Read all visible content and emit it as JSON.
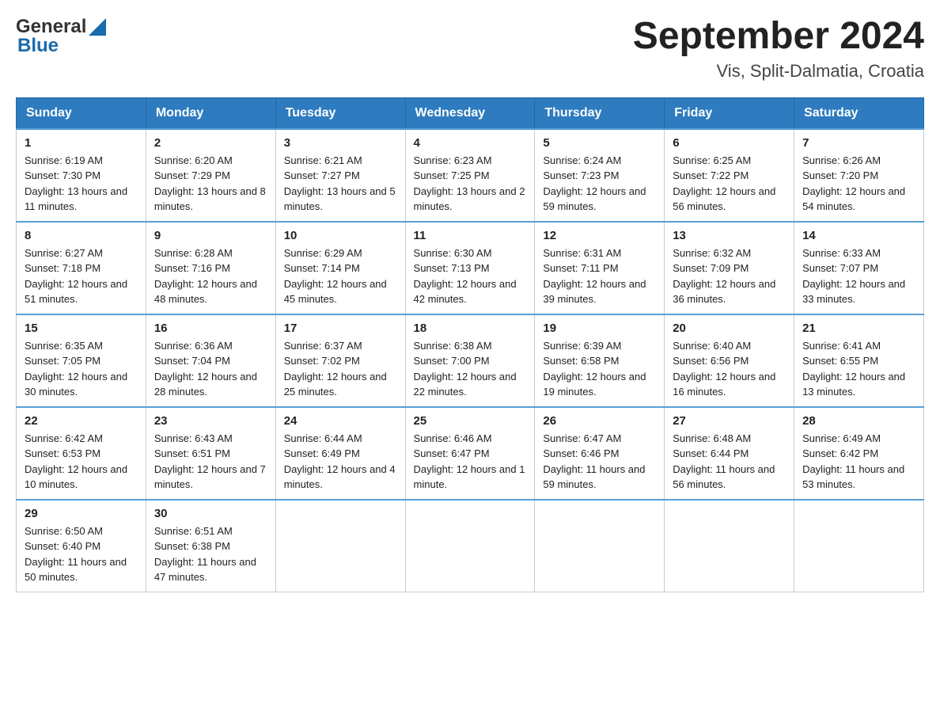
{
  "header": {
    "logo": {
      "general": "General",
      "blue": "Blue"
    },
    "title": "September 2024",
    "location": "Vis, Split-Dalmatia, Croatia"
  },
  "weekdays": [
    "Sunday",
    "Monday",
    "Tuesday",
    "Wednesday",
    "Thursday",
    "Friday",
    "Saturday"
  ],
  "weeks": [
    [
      {
        "day": "1",
        "sunrise": "6:19 AM",
        "sunset": "7:30 PM",
        "daylight": "13 hours and 11 minutes."
      },
      {
        "day": "2",
        "sunrise": "6:20 AM",
        "sunset": "7:29 PM",
        "daylight": "13 hours and 8 minutes."
      },
      {
        "day": "3",
        "sunrise": "6:21 AM",
        "sunset": "7:27 PM",
        "daylight": "13 hours and 5 minutes."
      },
      {
        "day": "4",
        "sunrise": "6:23 AM",
        "sunset": "7:25 PM",
        "daylight": "13 hours and 2 minutes."
      },
      {
        "day": "5",
        "sunrise": "6:24 AM",
        "sunset": "7:23 PM",
        "daylight": "12 hours and 59 minutes."
      },
      {
        "day": "6",
        "sunrise": "6:25 AM",
        "sunset": "7:22 PM",
        "daylight": "12 hours and 56 minutes."
      },
      {
        "day": "7",
        "sunrise": "6:26 AM",
        "sunset": "7:20 PM",
        "daylight": "12 hours and 54 minutes."
      }
    ],
    [
      {
        "day": "8",
        "sunrise": "6:27 AM",
        "sunset": "7:18 PM",
        "daylight": "12 hours and 51 minutes."
      },
      {
        "day": "9",
        "sunrise": "6:28 AM",
        "sunset": "7:16 PM",
        "daylight": "12 hours and 48 minutes."
      },
      {
        "day": "10",
        "sunrise": "6:29 AM",
        "sunset": "7:14 PM",
        "daylight": "12 hours and 45 minutes."
      },
      {
        "day": "11",
        "sunrise": "6:30 AM",
        "sunset": "7:13 PM",
        "daylight": "12 hours and 42 minutes."
      },
      {
        "day": "12",
        "sunrise": "6:31 AM",
        "sunset": "7:11 PM",
        "daylight": "12 hours and 39 minutes."
      },
      {
        "day": "13",
        "sunrise": "6:32 AM",
        "sunset": "7:09 PM",
        "daylight": "12 hours and 36 minutes."
      },
      {
        "day": "14",
        "sunrise": "6:33 AM",
        "sunset": "7:07 PM",
        "daylight": "12 hours and 33 minutes."
      }
    ],
    [
      {
        "day": "15",
        "sunrise": "6:35 AM",
        "sunset": "7:05 PM",
        "daylight": "12 hours and 30 minutes."
      },
      {
        "day": "16",
        "sunrise": "6:36 AM",
        "sunset": "7:04 PM",
        "daylight": "12 hours and 28 minutes."
      },
      {
        "day": "17",
        "sunrise": "6:37 AM",
        "sunset": "7:02 PM",
        "daylight": "12 hours and 25 minutes."
      },
      {
        "day": "18",
        "sunrise": "6:38 AM",
        "sunset": "7:00 PM",
        "daylight": "12 hours and 22 minutes."
      },
      {
        "day": "19",
        "sunrise": "6:39 AM",
        "sunset": "6:58 PM",
        "daylight": "12 hours and 19 minutes."
      },
      {
        "day": "20",
        "sunrise": "6:40 AM",
        "sunset": "6:56 PM",
        "daylight": "12 hours and 16 minutes."
      },
      {
        "day": "21",
        "sunrise": "6:41 AM",
        "sunset": "6:55 PM",
        "daylight": "12 hours and 13 minutes."
      }
    ],
    [
      {
        "day": "22",
        "sunrise": "6:42 AM",
        "sunset": "6:53 PM",
        "daylight": "12 hours and 10 minutes."
      },
      {
        "day": "23",
        "sunrise": "6:43 AM",
        "sunset": "6:51 PM",
        "daylight": "12 hours and 7 minutes."
      },
      {
        "day": "24",
        "sunrise": "6:44 AM",
        "sunset": "6:49 PM",
        "daylight": "12 hours and 4 minutes."
      },
      {
        "day": "25",
        "sunrise": "6:46 AM",
        "sunset": "6:47 PM",
        "daylight": "12 hours and 1 minute."
      },
      {
        "day": "26",
        "sunrise": "6:47 AM",
        "sunset": "6:46 PM",
        "daylight": "11 hours and 59 minutes."
      },
      {
        "day": "27",
        "sunrise": "6:48 AM",
        "sunset": "6:44 PM",
        "daylight": "11 hours and 56 minutes."
      },
      {
        "day": "28",
        "sunrise": "6:49 AM",
        "sunset": "6:42 PM",
        "daylight": "11 hours and 53 minutes."
      }
    ],
    [
      {
        "day": "29",
        "sunrise": "6:50 AM",
        "sunset": "6:40 PM",
        "daylight": "11 hours and 50 minutes."
      },
      {
        "day": "30",
        "sunrise": "6:51 AM",
        "sunset": "6:38 PM",
        "daylight": "11 hours and 47 minutes."
      },
      null,
      null,
      null,
      null,
      null
    ]
  ]
}
